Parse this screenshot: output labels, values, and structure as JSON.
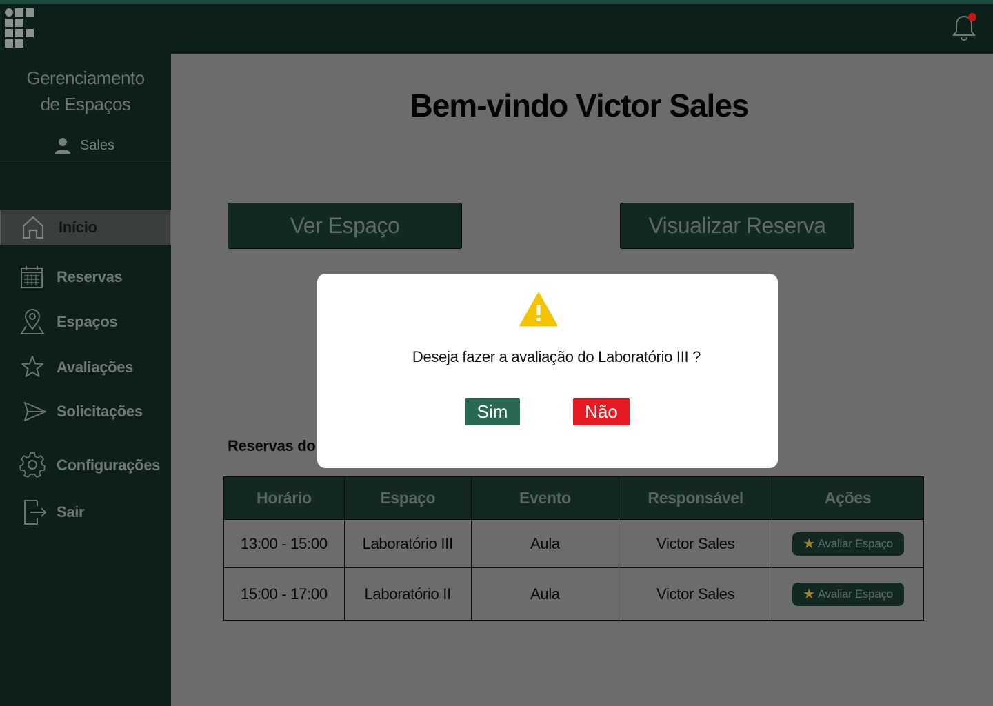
{
  "app": {
    "title_line1": "Gerenciamento",
    "title_line2": "de Espaços",
    "user_name": "Sales",
    "notification_icon": "bell-icon",
    "logo": "institution-logo"
  },
  "sidebar": {
    "items": [
      {
        "label": "Início",
        "icon": "home-icon",
        "active": true
      },
      {
        "label": "Reservas",
        "icon": "calendar-icon",
        "active": false
      },
      {
        "label": "Espaços",
        "icon": "location-pin-icon",
        "active": false
      },
      {
        "label": "Avaliações",
        "icon": "star-icon",
        "active": false
      },
      {
        "label": "Solicitações",
        "icon": "send-icon",
        "active": false
      },
      {
        "label": "Configurações",
        "icon": "gear-icon",
        "active": false
      },
      {
        "label": "Sair",
        "icon": "logout-icon",
        "active": false
      }
    ]
  },
  "main": {
    "welcome": "Bem-vindo Victor Sales",
    "btn_ver_espaco": "Ver Espaço",
    "btn_visualizar_reserva": "Visualizar Reserva",
    "section_title": "Reservas do D",
    "table": {
      "headers": [
        "Horário",
        "Espaço",
        "Evento",
        "Responsável",
        "Ações"
      ],
      "rows": [
        {
          "horario": "13:00 - 15:00",
          "espaco": "Laboratório III",
          "evento": "Aula",
          "responsavel": "Victor Sales",
          "acao": "Avaliar Espaço"
        },
        {
          "horario": "15:00 - 17:00",
          "espaco": "Laboratório II",
          "evento": "Aula",
          "responsavel": "Victor Sales",
          "acao": "Avaliar Espaço"
        }
      ]
    }
  },
  "modal": {
    "message": "Deseja fazer a avaliação do Laboratório III ?",
    "yes": "Sim",
    "no": "Não",
    "icon": "warning-icon"
  },
  "colors": {
    "dark_green": "#0d1f1b",
    "button_green": "#142823",
    "yes_green": "#2a6852",
    "no_red": "#e61a22",
    "warning_yellow": "#f5c400"
  }
}
